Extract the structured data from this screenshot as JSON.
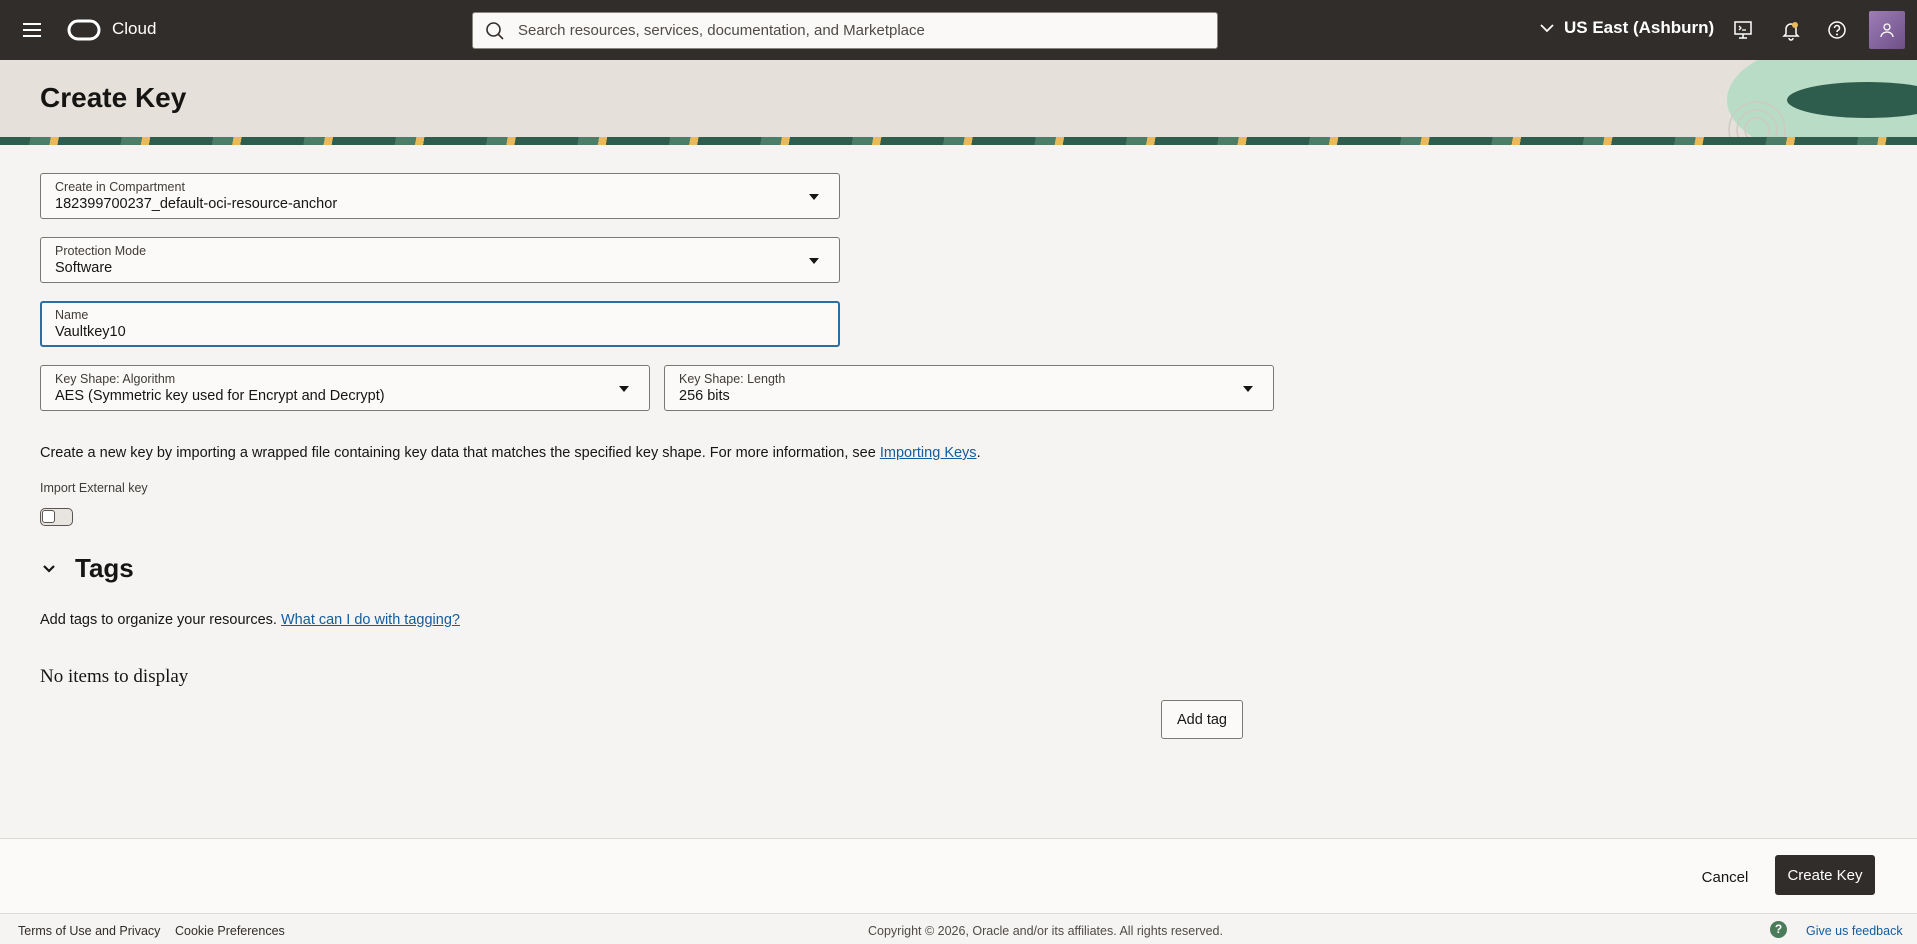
{
  "topbar": {
    "brand": "Cloud",
    "search_placeholder": "Search resources, services, documentation, and Marketplace",
    "region": "US East (Ashburn)"
  },
  "page": {
    "title": "Create Key"
  },
  "form": {
    "compartment": {
      "label": "Create in Compartment",
      "value": "182399700237_default-oci-resource-anchor"
    },
    "protection_mode": {
      "label": "Protection Mode",
      "value": "Software"
    },
    "name": {
      "label": "Name",
      "value": "Vaultkey10"
    },
    "algorithm": {
      "label": "Key Shape: Algorithm",
      "value": "AES (Symmetric key used for Encrypt and Decrypt)"
    },
    "length": {
      "label": "Key Shape: Length",
      "value": "256 bits"
    },
    "import_info": "Create a new key by importing a wrapped file containing key data that matches the specified key shape. For more information, see ",
    "import_info_link": "Importing Keys",
    "import_info_end": ".",
    "import_label": "Import External key"
  },
  "tags": {
    "title": "Tags",
    "help": "Add tags to organize your resources. ",
    "help_link": "What can I do with tagging?",
    "empty": "No items to display",
    "add_label": "Add tag"
  },
  "actions": {
    "cancel": "Cancel",
    "create": "Create Key"
  },
  "footer": {
    "terms": "Terms of Use and Privacy",
    "cookies": "Cookie Preferences",
    "copyright": "Copyright © 2026, Oracle and/or its affiliates. All rights reserved.",
    "help": "?",
    "feedback": "Give us feedback"
  },
  "colors": {
    "topbar": "#312d2a",
    "primary_button": "#312d2a",
    "link": "#145c9e",
    "focus": "#2b6ea3"
  }
}
